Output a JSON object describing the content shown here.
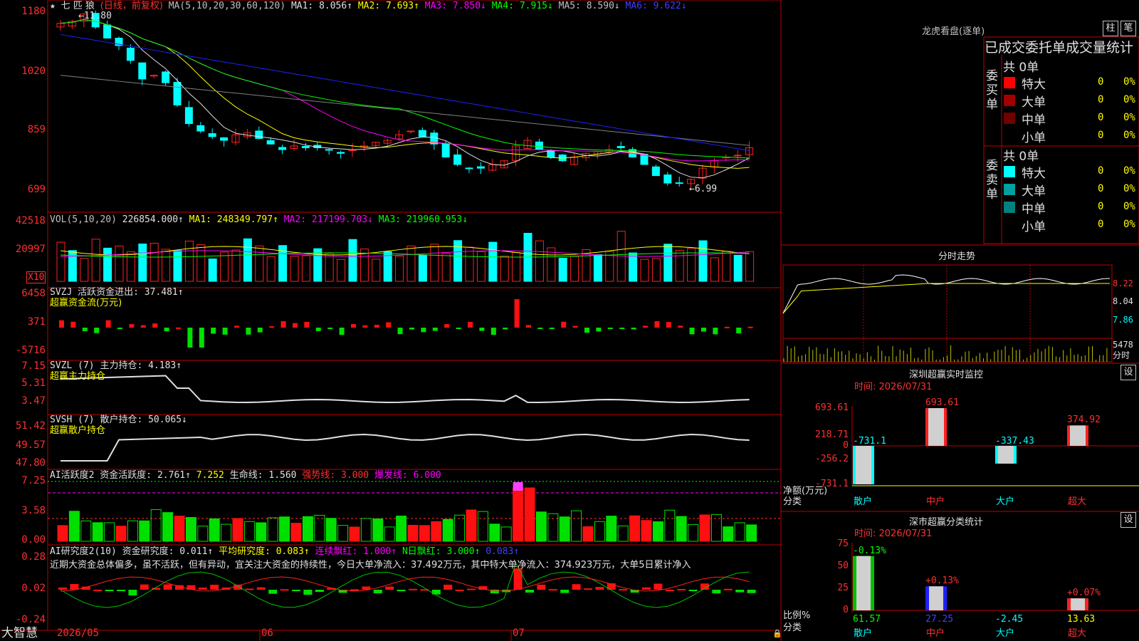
{
  "stock": {
    "name": "七 匹 狼",
    "mode": "(日线，前复权)",
    "star": "★",
    "arrow": "↑"
  },
  "main_chart": {
    "ma_label": "MA(5,10,20,30,60,120)",
    "ma1": "MA1: 8.056↑",
    "ma2": "MA2: 7.693↑",
    "ma3": "MA3: 7.850↓",
    "ma4": "MA4: 7.915↓",
    "ma5": "MA5: 8.590↓",
    "ma6": "MA6: 9.622↓",
    "high_mark": "←11.80",
    "low_mark": "←6.99",
    "y_ticks": [
      "1180",
      "1020",
      "859",
      "699"
    ]
  },
  "vol": {
    "label": "VOL(5,10,20)",
    "value": "226854.000↑",
    "ma1": "MA1: 248349.797↑",
    "ma2": "MA2: 217199.703↓",
    "ma3": "MA3: 219960.953↓",
    "y_ticks": [
      "42518",
      "20997"
    ],
    "unit": "X10"
  },
  "svzj": {
    "label": "SVZJ  活跃资金进出: 37.481↑",
    "sub": "超赢资金流(万元)",
    "y_ticks": [
      "6458",
      "371",
      "-5716"
    ]
  },
  "svzl": {
    "label": "SVZL (7) 主力持仓: 4.183↑",
    "sub": "超赢主力持仓",
    "y_ticks": [
      "7.15",
      "5.31",
      "3.47"
    ]
  },
  "svsh": {
    "label": "SVSH (7) 散户持仓: 50.065↓",
    "sub": "超赢散户持仓",
    "y_ticks": [
      "51.42",
      "49.57",
      "47.80"
    ]
  },
  "ai1": {
    "label": "AI活跃度2 资金活跃度: 2.761↑",
    "v2": "7.252",
    "v3": "生命线: 1.560",
    "v4": "强势线: 3.000",
    "v5": "爆发线: 6.000",
    "y_ticks": [
      "7.25",
      "3.58",
      "0.00"
    ]
  },
  "ai2": {
    "label": "AI研究度2(10) 资金研究度: 0.011↑",
    "avg": "平均研究度: 0.083↑",
    "red": "连续飘红: 1.000↑",
    "nred": "N日飘红: 3.000↑",
    "last": "0.083↑",
    "comment": "近期大资金总体偏多，虽不活跃，但有异动，宜关注大资金的持续性，今日大单净流入：37.492万元，其中特大单净流入：374.923万元，大单5日累计净入",
    "y_ticks": [
      "0.28",
      "0.02",
      "-0.24"
    ]
  },
  "footer": {
    "brand": "大智慧",
    "dates": [
      "2026/05",
      "06",
      "07"
    ]
  },
  "right": {
    "dragon_title": "龙虎看盘(逐单)",
    "btn_zhu": "柱",
    "btn_bi": "笔",
    "stats_title": "已成交委托单成交量统计",
    "buy": {
      "side": "委买单",
      "total": "共 0单",
      "rows": [
        {
          "name": "特大",
          "val": "0",
          "pct": "0%",
          "color": "#ff0000"
        },
        {
          "name": "大单",
          "val": "0",
          "pct": "0%",
          "color": "#a00000"
        },
        {
          "name": "中单",
          "val": "0",
          "pct": "0%",
          "color": "#700000"
        },
        {
          "name": "小单",
          "val": "0",
          "pct": "0%",
          "color": ""
        }
      ]
    },
    "sell": {
      "side": "委卖单",
      "total": "共 0单",
      "rows": [
        {
          "name": "特大",
          "val": "0",
          "pct": "0%",
          "color": "#00ffff"
        },
        {
          "name": "大单",
          "val": "0",
          "pct": "0%",
          "color": "#00a0a0"
        },
        {
          "name": "中单",
          "val": "0",
          "pct": "0%",
          "color": "#008080"
        },
        {
          "name": "小单",
          "val": "0",
          "pct": "0%",
          "color": ""
        }
      ]
    },
    "intraday": {
      "title": "分时走势",
      "prices": [
        "8.22",
        "8.04",
        "7.86"
      ],
      "vol": "5478",
      "vol_label": "分时"
    },
    "monitor": {
      "title": "深圳超赢实时监控",
      "btn": "设",
      "time": "时间: 2026/07/31",
      "ylabel": "净额(万元)",
      "xlabel": "分类",
      "y_ticks": [
        "693.61",
        "218.71",
        "0",
        "-256.2",
        "-731.1"
      ],
      "categories": [
        "散户",
        "中户",
        "大户",
        "超大"
      ],
      "values": [
        -731.1,
        693.61,
        -337.43,
        374.92
      ],
      "labels": [
        "-731.1",
        "693.61",
        "-337.43",
        "374.92"
      ]
    },
    "classify": {
      "title": "深市超赢分类统计",
      "btn": "设",
      "time": "时间: 2026/07/31",
      "ylabel": "比例%",
      "xlabel": "分类",
      "y_ticks": [
        "75",
        "50",
        "25",
        "0"
      ],
      "categories": [
        "散户",
        "中户",
        "大户",
        "超大"
      ],
      "top_labels": [
        "-0.13%",
        "+0.13%",
        "",
        "+0.07%"
      ],
      "values": [
        61.57,
        27.25,
        -2.45,
        13.63
      ],
      "labels": [
        "61.57",
        "27.25",
        "-2.45",
        "13.63"
      ]
    }
  },
  "colors": {
    "up": "#ff2020",
    "down": "#00ffff",
    "ma1": "#e0e0e0",
    "ma2": "#ffff00",
    "ma3": "#ff00ff",
    "ma4": "#00ff00",
    "ma5": "#808080",
    "ma6": "#2020ff",
    "frame": "#c00000"
  }
}
